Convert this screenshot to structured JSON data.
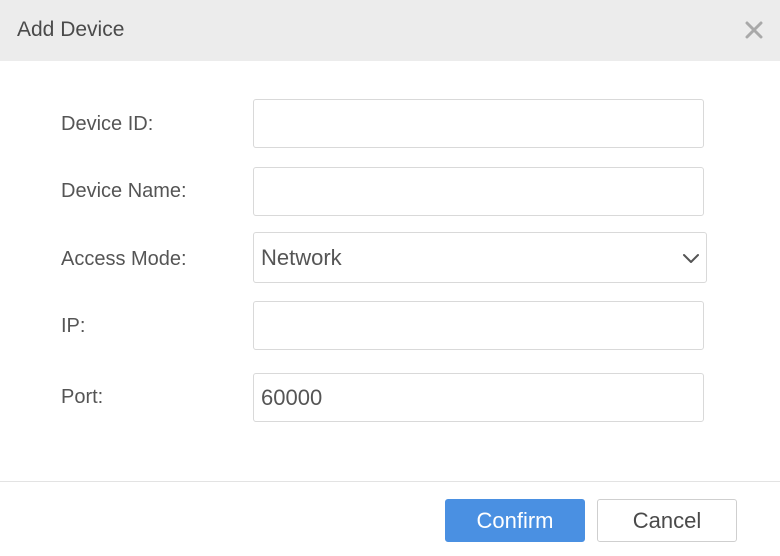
{
  "dialog": {
    "title": "Add Device",
    "close_icon": "close-icon"
  },
  "form": {
    "device_id": {
      "label": "Device ID:",
      "value": ""
    },
    "device_name": {
      "label": "Device Name:",
      "value": ""
    },
    "access_mode": {
      "label": "Access Mode:",
      "selected": "Network",
      "icon": "chevron-down-icon"
    },
    "ip": {
      "label": "IP:",
      "value": ""
    },
    "port": {
      "label": "Port:",
      "value": "60000"
    }
  },
  "footer": {
    "confirm_label": "Confirm",
    "cancel_label": "Cancel"
  },
  "colors": {
    "header_bg": "#ececec",
    "primary": "#4a90e2",
    "border": "#d9d9d9",
    "text": "#555555"
  }
}
